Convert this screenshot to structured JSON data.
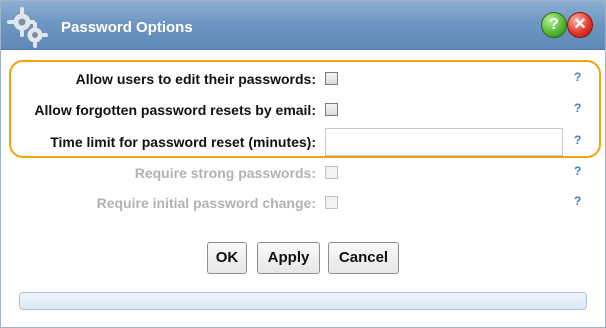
{
  "dialog": {
    "title": "Password Options",
    "icons": {
      "app": "gears-icon",
      "help": "help-icon",
      "close": "close-icon"
    },
    "help_glyph": "?",
    "close_glyph": "✕"
  },
  "fields": [
    {
      "label": "Allow users to edit their passwords:",
      "type": "checkbox",
      "checked": false,
      "enabled": true,
      "help": "?"
    },
    {
      "label": "Allow forgotten password resets by email:",
      "type": "checkbox",
      "checked": false,
      "enabled": true,
      "help": "?"
    },
    {
      "label": "Time limit for password reset (minutes):",
      "type": "text",
      "value": "",
      "enabled": true,
      "help": "?"
    },
    {
      "label": "Require strong passwords:",
      "type": "checkbox",
      "checked": false,
      "enabled": false,
      "help": "?"
    },
    {
      "label": "Require initial password change:",
      "type": "checkbox",
      "checked": false,
      "enabled": false,
      "help": "?"
    }
  ],
  "buttons": {
    "ok": "OK",
    "apply": "Apply",
    "cancel": "Cancel"
  },
  "colors": {
    "highlight": "#f0a30a",
    "help_link": "#3b7fc4",
    "disabled_text": "#b2b2b2"
  }
}
